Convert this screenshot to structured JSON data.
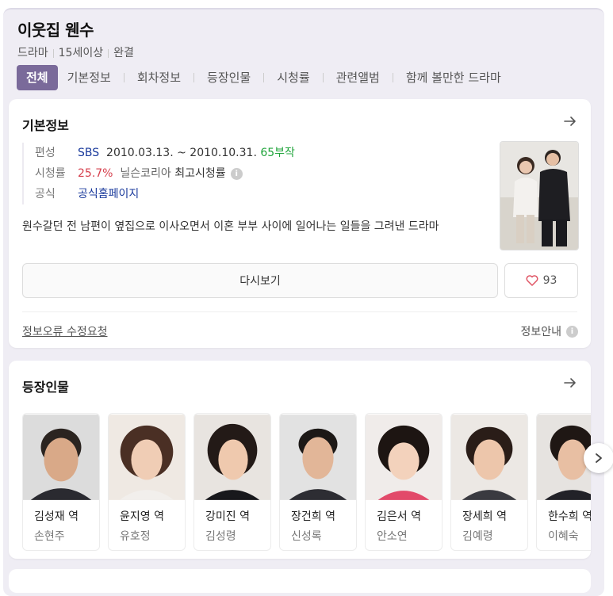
{
  "header": {
    "title": "이웃집 웬수",
    "meta": [
      "드라마",
      "15세이상",
      "완결"
    ]
  },
  "tabs": [
    "전체",
    "기본정보",
    "회차정보",
    "등장인물",
    "시청률",
    "관련앨범",
    "함께 볼만한 드라마"
  ],
  "basic_info": {
    "title": "기본정보",
    "rows": {
      "broadcast": {
        "key": "편성",
        "channel": "SBS",
        "period": "2010.03.13. ~ 2010.10.31.",
        "episodes": "65부작"
      },
      "ratings": {
        "key": "시청률",
        "value": "25.7%",
        "source": "닐슨코리아",
        "label": "최고시청률"
      },
      "official": {
        "key": "공식",
        "link": "공식홈페이지"
      }
    },
    "description": "원수갈던 전 남편이 옆집으로 이사오면서 이혼 부부 사이에 일어나는 일들을 그려낸 드라마",
    "rewatch_label": "다시보기",
    "like_count": "93",
    "report_label": "정보오류 수정요청",
    "guide_label": "정보안내"
  },
  "cast": {
    "title": "등장인물",
    "items": [
      {
        "role": "김성재 역",
        "actor": "손현주"
      },
      {
        "role": "윤지영 역",
        "actor": "유호정"
      },
      {
        "role": "강미진 역",
        "actor": "김성령"
      },
      {
        "role": "장건희 역",
        "actor": "신성록"
      },
      {
        "role": "김은서 역",
        "actor": "안소연"
      },
      {
        "role": "장세희 역",
        "actor": "김예령"
      },
      {
        "role": "한수희 역",
        "actor": "이혜숙"
      }
    ]
  },
  "colors": {
    "accent": "#7a6a9a",
    "background": "#efedf4",
    "episodes_green": "#20a43b",
    "rating_red": "#d6404e",
    "link_blue": "#1a3a9c"
  }
}
